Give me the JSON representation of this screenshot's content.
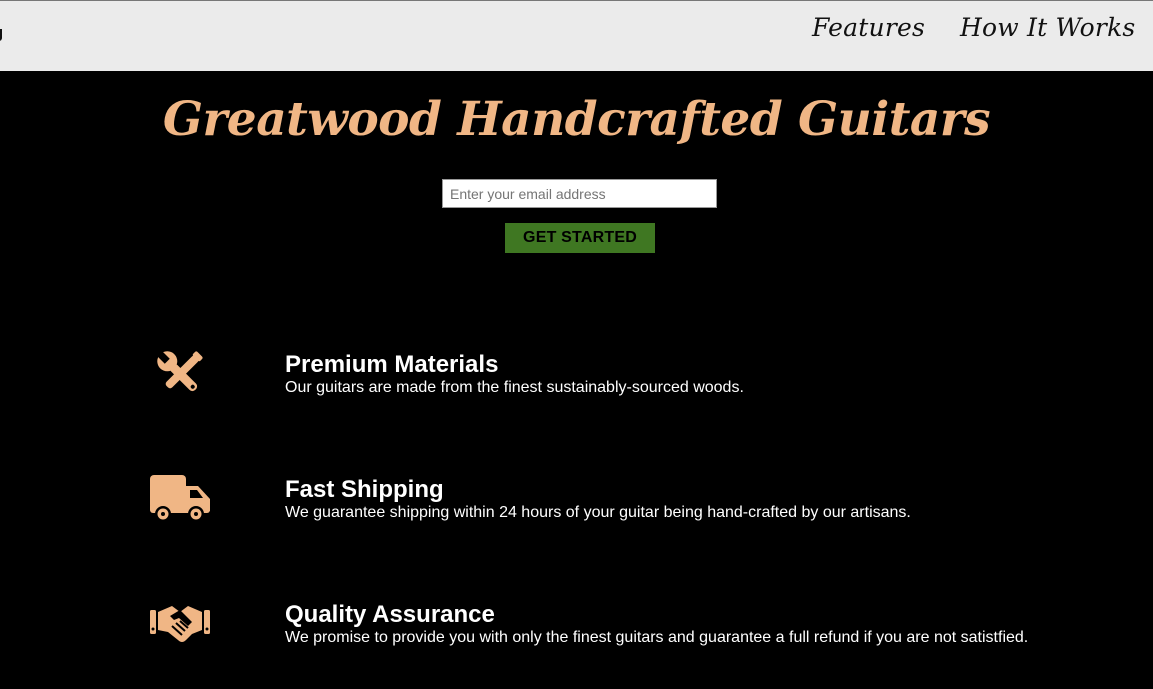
{
  "nav": {
    "links": [
      {
        "label": "Features"
      },
      {
        "label": "How It Works"
      }
    ]
  },
  "hero": {
    "title": "Greatwood Handcrafted Guitars",
    "email_placeholder": "Enter your email address",
    "email_value": "",
    "cta_label": "GET STARTED"
  },
  "features": [
    {
      "icon": "tools-icon",
      "title": "Premium Materials",
      "description": "Our guitars are made from the finest sustainably-sourced woods."
    },
    {
      "icon": "truck-icon",
      "title": "Fast Shipping",
      "description": "We guarantee shipping within 24 hours of your guitar being hand-crafted by our artisans."
    },
    {
      "icon": "handshake-icon",
      "title": "Quality Assurance",
      "description": "We promise to provide you with only the finest guitars and guarantee a full refund if you are not satistfied."
    }
  ],
  "colors": {
    "accent": "#f0b685",
    "button": "#3f7722",
    "navbar": "#ebebeb",
    "background": "#000000"
  }
}
